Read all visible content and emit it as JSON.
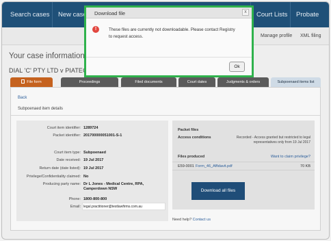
{
  "topnav": {
    "search_cases": "Search cases",
    "new_case": "New case",
    "court_lists": "Court Lists",
    "probate": "Probate"
  },
  "subnav": {
    "manage_profile": "Manage profile",
    "xml_filing": "XML filing"
  },
  "page": {
    "title": "Your case information",
    "case_name": "DIAL 'C' PTY LTD v PIATECH"
  },
  "tabs": {
    "file_form": "File form",
    "proceedings": "Proceedings",
    "filed_documents": "Filed documents",
    "court_dates": "Court dates",
    "judgments_orders": "Judgments & orders",
    "subpoenaed_items_list": "Subpoenaed items list"
  },
  "panel": {
    "back": "Back",
    "title": "Subpoenaed item details",
    "details": {
      "court_item_identifier_label": "Court item identifier:",
      "court_item_identifier": "1289724",
      "packet_identifier_label": "Packet identifier:",
      "packet_identifier": "201700000051001-S-1",
      "court_item_type_label": "Court item type:",
      "court_item_type": "Subpoenaed",
      "date_received_label": "Date received:",
      "date_received": "19 Jul 2017",
      "return_date_label": "Return date (date listed):",
      "return_date": "19 Jul 2017",
      "privilege_label": "Privilege/Confidentiality claimed:",
      "privilege": "No",
      "producing_party_label": "Producing party name:",
      "producing_party": "Dr L Jones - Medical Centre, RPA, Camperdown NSW",
      "phone_label": "Phone:",
      "phone": "1800-800-800",
      "email_label": "Email:",
      "email": "legal.practitioner@testlawfirms.com.au"
    },
    "packet": {
      "title": "Packet files",
      "access_conditions_label": "Access conditions",
      "access_conditions": "Recorded - Access granted but restricted to legal representatives only from 19 Jul 2017",
      "files_produced_label": "Files produced",
      "claim_privilege": "Want to claim privilege?",
      "file_id": "E59-0001",
      "file_name": "Form_46_Affidavit.pdf",
      "file_size": "70 KB",
      "download_all": "Download all files"
    },
    "help": {
      "text": "Need help?",
      "contact": "Contact us"
    }
  },
  "modal": {
    "title": "Download file",
    "close": "x",
    "icon": "error-icon",
    "message": "These files are currently not downloadable. Please contact Registry to request access.",
    "ok": "Ok"
  },
  "colors": {
    "nav_bg": "#1f5078",
    "active_tab": "#c5621f",
    "modal_border": "#2fb24c",
    "link": "#2a5d9a"
  }
}
